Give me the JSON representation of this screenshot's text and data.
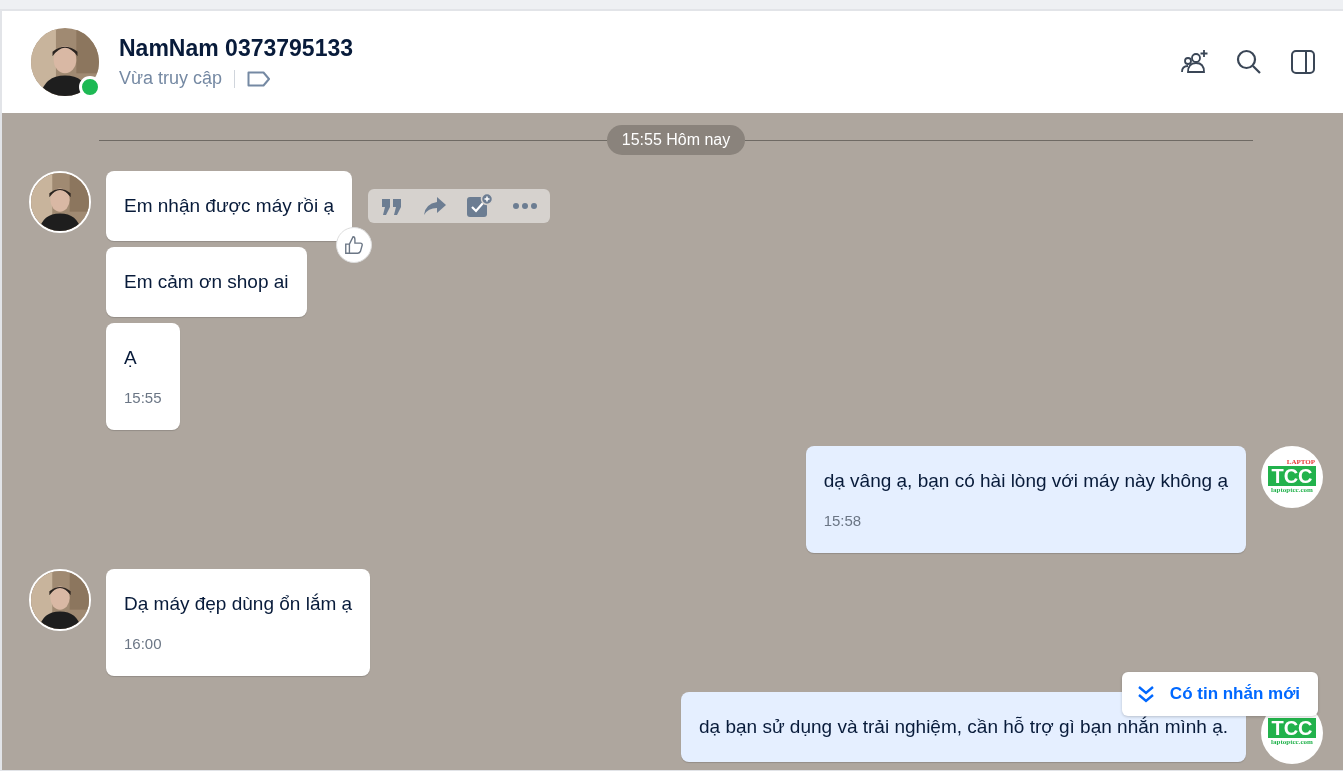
{
  "header": {
    "name": "NamNam 0373795133",
    "status": "Vừa truy cập",
    "online": true
  },
  "divider": {
    "label": "15:55 Hôm nay"
  },
  "groups": [
    {
      "outgoing": false,
      "avatar": {
        "kind": "picture"
      },
      "bubbles": [
        {
          "text": "Em nhận được máy rồi ạ",
          "reaction": true,
          "actions": true
        },
        {
          "text": "Em cảm ơn shop ai"
        },
        {
          "text": "Ạ",
          "time": "15:55"
        }
      ]
    },
    {
      "outgoing": true,
      "avatar": {
        "kind": "logo",
        "top": "LAPTOP",
        "mark": "TCC",
        "url": "laptoptcc.com"
      },
      "bubbles": [
        {
          "text": "dạ vâng ạ, bạn có hài lòng với máy này không ạ",
          "time": "15:58"
        }
      ]
    },
    {
      "outgoing": false,
      "avatar": {
        "kind": "picture"
      },
      "bubbles": [
        {
          "text": "Dạ máy đẹp dùng ổn lắm ạ",
          "time": "16:00"
        }
      ]
    },
    {
      "outgoing": true,
      "avatar": {
        "kind": "logo",
        "mark": "TCC",
        "url": "laptoptcc.com"
      },
      "bubbles": [
        {
          "text": "dạ bạn sử dụng và trải nghiệm, cần hỗ trợ gì bạn nhắn mình ạ."
        }
      ]
    }
  ],
  "new_messages": {
    "label": "Có tin nhắn mới"
  }
}
